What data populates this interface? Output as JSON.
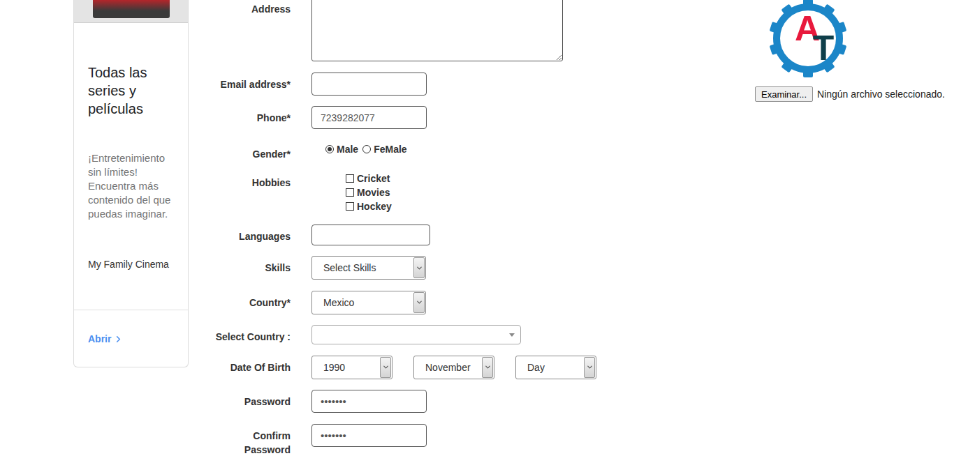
{
  "ad": {
    "title": "Todas las series y películas",
    "body": "¡Entretenimiento sin límites! Encuentra más contenido del que puedas imaginar.",
    "brand": "My Family Cinema",
    "link": "Abrir"
  },
  "form": {
    "fields": [
      {
        "kind": "textarea",
        "label": "Address",
        "value": ""
      },
      {
        "kind": "text",
        "label": "Email address*",
        "value": ""
      },
      {
        "kind": "text",
        "label": "Phone*",
        "value": "7239282077"
      },
      {
        "kind": "radio",
        "label": "Gender*",
        "options": [
          {
            "label": "Male",
            "selected": true
          },
          {
            "label": "FeMale",
            "selected": false
          }
        ]
      },
      {
        "kind": "checkbox",
        "label": "Hobbies",
        "options": [
          {
            "label": "Cricket",
            "checked": false
          },
          {
            "label": "Movies",
            "checked": false
          },
          {
            "label": "Hockey",
            "checked": false
          }
        ]
      },
      {
        "kind": "multi",
        "label": "Languages",
        "value": ""
      },
      {
        "kind": "select",
        "label": "Skills",
        "value": "Select Skills"
      },
      {
        "kind": "select",
        "label": "Country*",
        "value": "Mexico"
      },
      {
        "kind": "combo",
        "label": "Select Country :",
        "value": ""
      },
      {
        "kind": "date",
        "label": "Date Of Birth",
        "parts": [
          "1990",
          "November",
          "Day"
        ]
      },
      {
        "kind": "password",
        "label": "Password",
        "value": "•••••••"
      },
      {
        "kind": "password",
        "label": "Confirm Password",
        "value": "•••••••"
      }
    ]
  },
  "logo": {
    "letters": [
      "A",
      "T"
    ]
  },
  "upload": {
    "button": "Examinar...",
    "status": "Ningún archivo seleccionado."
  }
}
